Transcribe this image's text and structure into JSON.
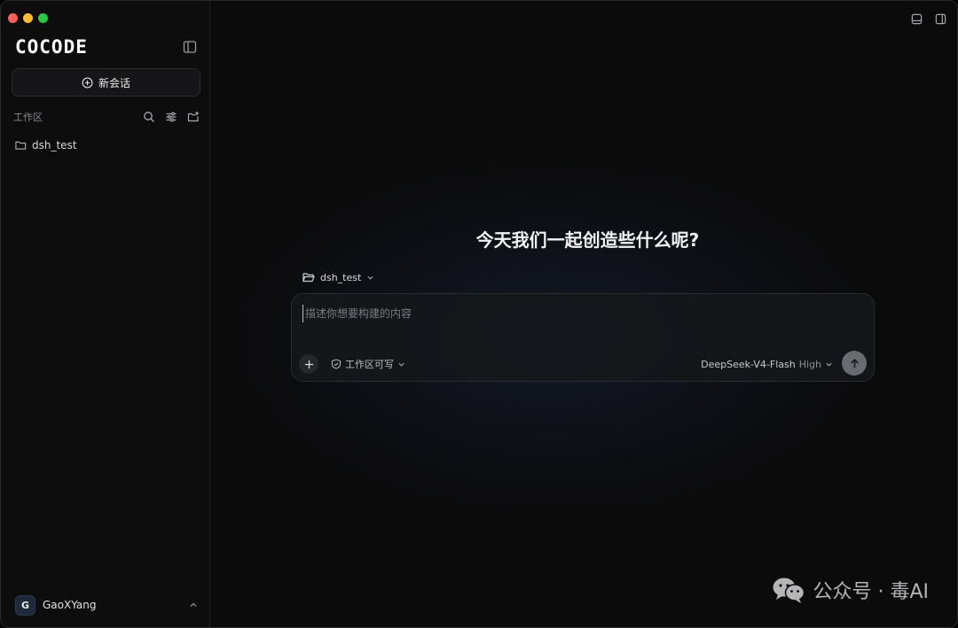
{
  "app": {
    "logo_text": "COCODE"
  },
  "sidebar": {
    "new_chat_label": "新会话",
    "workspace_label": "工作区",
    "tree": [
      {
        "name": "dsh_test",
        "type": "folder"
      }
    ],
    "user": {
      "initial": "G",
      "name": "GaoXYang"
    }
  },
  "main": {
    "greeting": "今天我们一起创造些什么呢?",
    "folder_select": "dsh_test",
    "composer": {
      "placeholder": "描述你想要构建的内容",
      "permission_label": "工作区可写",
      "model_name": "DeepSeek-V4-Flash",
      "model_level": "High"
    }
  },
  "watermark": {
    "text": "公众号 · 毒AI"
  },
  "colors": {
    "close": "#fe5f57",
    "minimize": "#febc2e",
    "maximize": "#28c840",
    "send": "#6a6b70"
  }
}
